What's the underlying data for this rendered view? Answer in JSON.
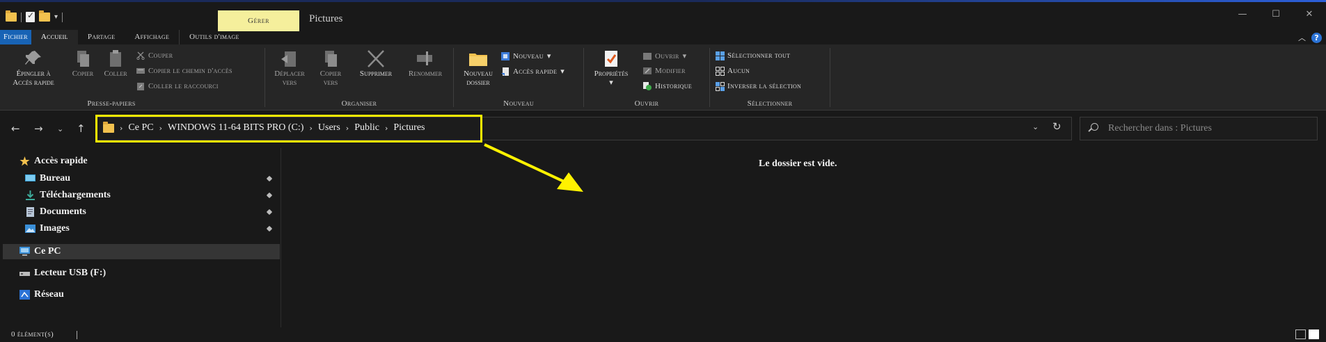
{
  "window": {
    "title": "Pictures",
    "contextual_tab": "Gérer",
    "controls": {
      "minimize": "—",
      "maximize": "☐",
      "close": "✕"
    }
  },
  "ribbon_tabs": [
    {
      "label": "Fichier"
    },
    {
      "label": "Accueil"
    },
    {
      "label": "Partage"
    },
    {
      "label": "Affichage"
    },
    {
      "label": "Outils d'image"
    }
  ],
  "ribbon": {
    "presse_papiers": {
      "label": "Presse-papiers",
      "pin_line1": "Épingler à",
      "pin_line2": "Accès rapide",
      "copier": "Copier",
      "coller": "Coller",
      "couper": "Couper",
      "copier_chemin": "Copier le chemin d'accès",
      "coller_raccourci": "Coller le raccourci"
    },
    "organiser": {
      "label": "Organiser",
      "deplacer_line1": "Déplacer",
      "deplacer_line2": "vers",
      "copier_line1": "Copier",
      "copier_line2": "vers",
      "supprimer": "Supprimer",
      "renommer": "Renommer"
    },
    "nouveau": {
      "label": "Nouveau",
      "nouveau_dossier_line1": "Nouveau",
      "nouveau_dossier_line2": "dossier",
      "nouvel_element": "Nouveau",
      "acces_rapide": "Accès rapide"
    },
    "ouvrir": {
      "label": "Ouvrir",
      "proprietes": "Propriétés",
      "ouvrir": "Ouvrir",
      "modifier": "Modifier",
      "historique": "Historique"
    },
    "selectionner": {
      "label": "Sélectionner",
      "tout": "Sélectionner tout",
      "aucun": "Aucun",
      "inverser": "Inverser la sélection"
    }
  },
  "address": {
    "crumbs": [
      "Ce PC",
      "WINDOWS 11-64 BITS PRO (C:)",
      "Users",
      "Public",
      "Pictures"
    ]
  },
  "search": {
    "placeholder": "Rechercher dans : Pictures"
  },
  "nav": {
    "quick_access": "Accès rapide",
    "items": [
      "Bureau",
      "Téléchargements",
      "Documents",
      "Images"
    ],
    "ce_pc": "Ce PC",
    "usb": "Lecteur USB (F:)",
    "reseau": "Réseau"
  },
  "content": {
    "empty_message": "Le dossier est vide."
  },
  "status": {
    "count": "0 élément(s)"
  },
  "colors": {
    "highlight_border": "#fff200",
    "annotation_arrow": "#fff200",
    "fichier_tab": "#1863b5",
    "gerer_tab": "#f5ef9c"
  }
}
